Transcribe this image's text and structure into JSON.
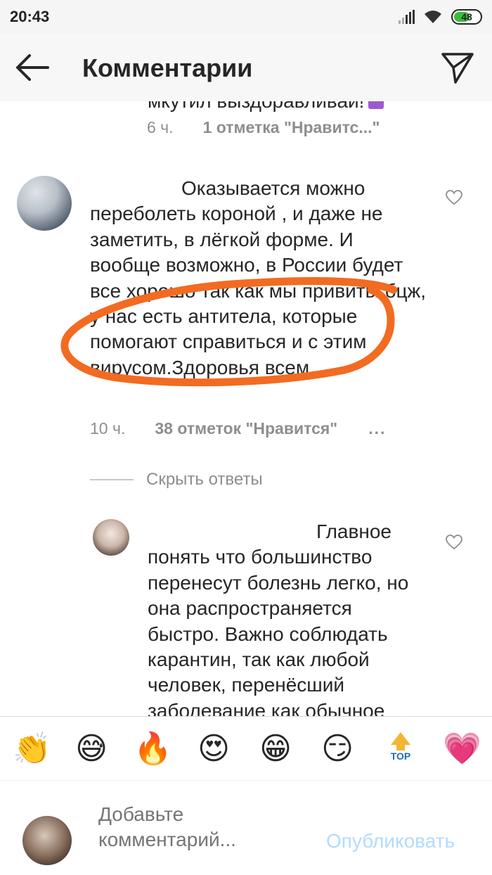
{
  "status_bar": {
    "time": "20:43",
    "battery": "48"
  },
  "header": {
    "title": "Комментарии"
  },
  "comments": [
    {
      "clipped_text": "мкутил выздоравливай!",
      "time": "6 ч.",
      "likes": "1 отметка \"Нравитс...\""
    },
    {
      "text": "Оказывается можно переболеть короной , и даже не заметить, в лёгкой форме. И вообще возможно, в России будет все хорошо так как мы привиты бцж, у нас есть антитела, которые помогают справиться и с этим вирусом.Здоровья всем.",
      "time": "10 ч.",
      "likes": "38 отметок \"Нравится\"",
      "more": "..."
    }
  ],
  "hide_replies": "Скрыть ответы",
  "reply": {
    "text": "Главное понять что большинство перенесут болезнь легко, но она распространяется быстро. Важно соблюдать карантин, так как любой человек, перенёсший заболевание как обычное"
  },
  "emoji_bar": {
    "items": [
      "👏",
      "😅",
      "🔥",
      "😍",
      "😁",
      "😏",
      "TOP",
      "💗"
    ]
  },
  "input": {
    "placeholder": "Добавьте комментарий...",
    "publish_label": "Опубликовать"
  },
  "colors": {
    "accent_link": "#b3dbff",
    "scribble": "#f26b21",
    "muted_text": "#8e8e8e"
  }
}
